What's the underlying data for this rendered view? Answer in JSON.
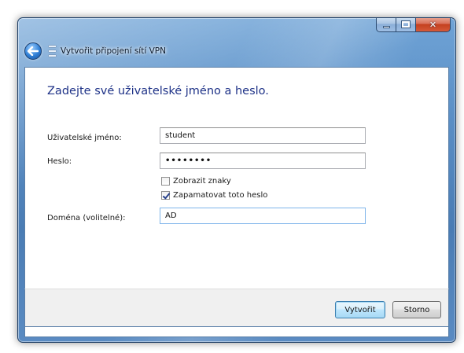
{
  "window": {
    "title": "Vytvořit připojení sítí VPN"
  },
  "caption_buttons": {
    "close_glyph": "✕"
  },
  "page": {
    "heading": "Zadejte své uživatelské jméno a heslo."
  },
  "form": {
    "username": {
      "label": "Uživatelské jméno:",
      "value": "student"
    },
    "password": {
      "label": "Heslo:",
      "value": "••••••••"
    },
    "show_chars": {
      "label": "Zobrazit znaky",
      "checked": false
    },
    "remember": {
      "label": "Zapamatovat toto heslo",
      "checked": true
    },
    "domain": {
      "label": "Doména (volitelné):",
      "value": "AD"
    }
  },
  "footer": {
    "create_label": "Vytvořit",
    "cancel_label": "Storno"
  },
  "icons": {
    "back": "back-arrow-icon",
    "network": "network-icon"
  },
  "colors": {
    "heading": "#1e3287",
    "frame": "#5b8fc6",
    "close": "#c4401f"
  }
}
